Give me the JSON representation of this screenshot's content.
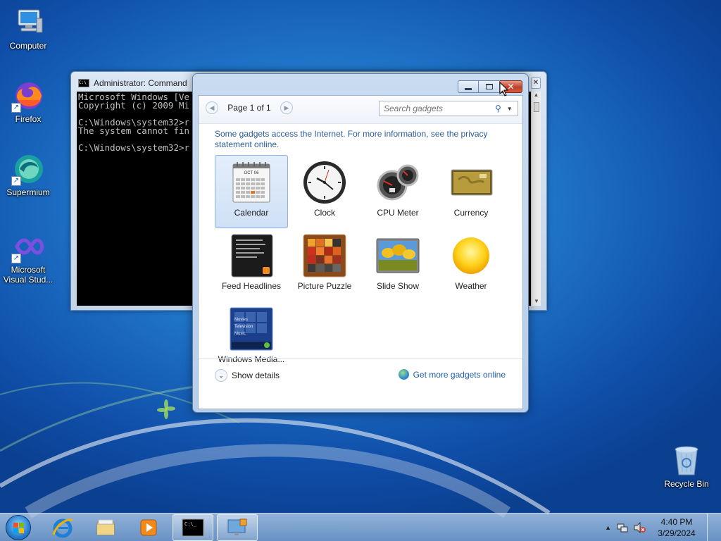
{
  "desktop": {
    "icons": [
      {
        "label": "Computer"
      },
      {
        "label": "Firefox"
      },
      {
        "label": "Supermium"
      },
      {
        "label": "Microsoft Visual Stud..."
      },
      {
        "label": "Recycle Bin"
      }
    ]
  },
  "cmd_window": {
    "title": "Administrator: Command",
    "lines": [
      "Microsoft Windows [Ve",
      "Copyright (c) 2009 Mi",
      "",
      "C:\\Windows\\system32>r",
      "The system cannot fin",
      "",
      "C:\\Windows\\system32>r"
    ]
  },
  "gadget_gallery": {
    "page_label": "Page 1 of 1",
    "search_placeholder": "Search gadgets",
    "info_text": "Some gadgets access the Internet.  For more information, see the privacy statement online.",
    "gadgets": [
      {
        "label": "Calendar",
        "selected": true
      },
      {
        "label": "Clock"
      },
      {
        "label": "CPU Meter"
      },
      {
        "label": "Currency"
      },
      {
        "label": "Feed Headlines"
      },
      {
        "label": "Picture Puzzle"
      },
      {
        "label": "Slide Show"
      },
      {
        "label": "Weather"
      },
      {
        "label": "Windows Media..."
      }
    ],
    "calendar_month": "OCT 06",
    "media_lines": [
      "Movies",
      "Television",
      "Music"
    ],
    "show_details": "Show details",
    "more_online": "Get more gadgets online"
  },
  "taskbar": {
    "time": "4:40 PM",
    "date": "3/29/2024"
  },
  "colors": {
    "accent": "#2a5d9e",
    "link": "#1f5fae",
    "close_button": "#c0402a"
  }
}
